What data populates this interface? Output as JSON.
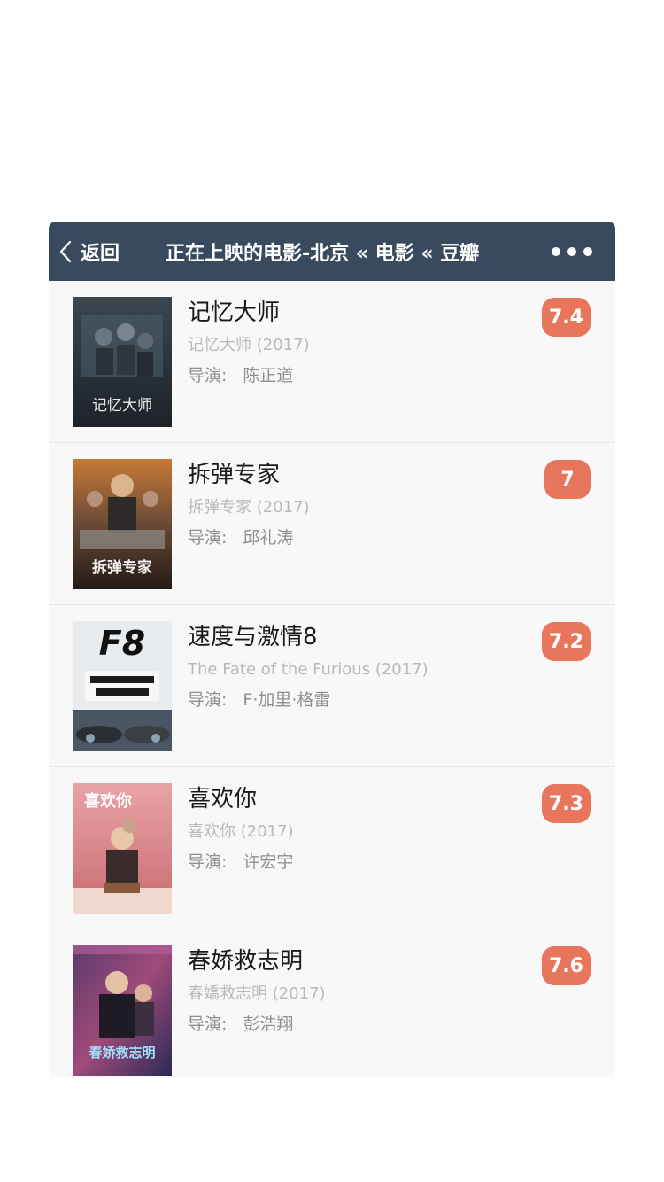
{
  "navbar": {
    "back_label": "返回",
    "title": "正在上映的电影-北京 « 电影 « 豆瓣"
  },
  "colors": {
    "navbar_bg": "#394a5f",
    "rating_bg": "#e8765c",
    "list_bg": "#f8f8f8"
  },
  "movies": [
    {
      "title": "记忆大师",
      "original": "记忆大师 (2017)",
      "director_label": "导演:",
      "director": "陈正道",
      "rating": "7.4",
      "poster_text": "记忆大师"
    },
    {
      "title": "拆弹专家",
      "original": "拆弹专家 (2017)",
      "director_label": "导演:",
      "director": "邱礼涛",
      "rating": "7",
      "poster_text": "拆弹专家"
    },
    {
      "title": "速度与激情8",
      "original": "The Fate of the Furious (2017)",
      "director_label": "导演:",
      "director": "F·加里·格雷",
      "rating": "7.2",
      "poster_text": "F8"
    },
    {
      "title": "喜欢你",
      "original": "喜欢你 (2017)",
      "director_label": "导演:",
      "director": "许宏宇",
      "rating": "7.3",
      "poster_text": "喜欢你"
    },
    {
      "title": "春娇救志明",
      "original": "春嬌救志明 (2017)",
      "director_label": "导演:",
      "director": "彭浩翔",
      "rating": "7.6",
      "poster_text": "春娇救志明"
    }
  ]
}
